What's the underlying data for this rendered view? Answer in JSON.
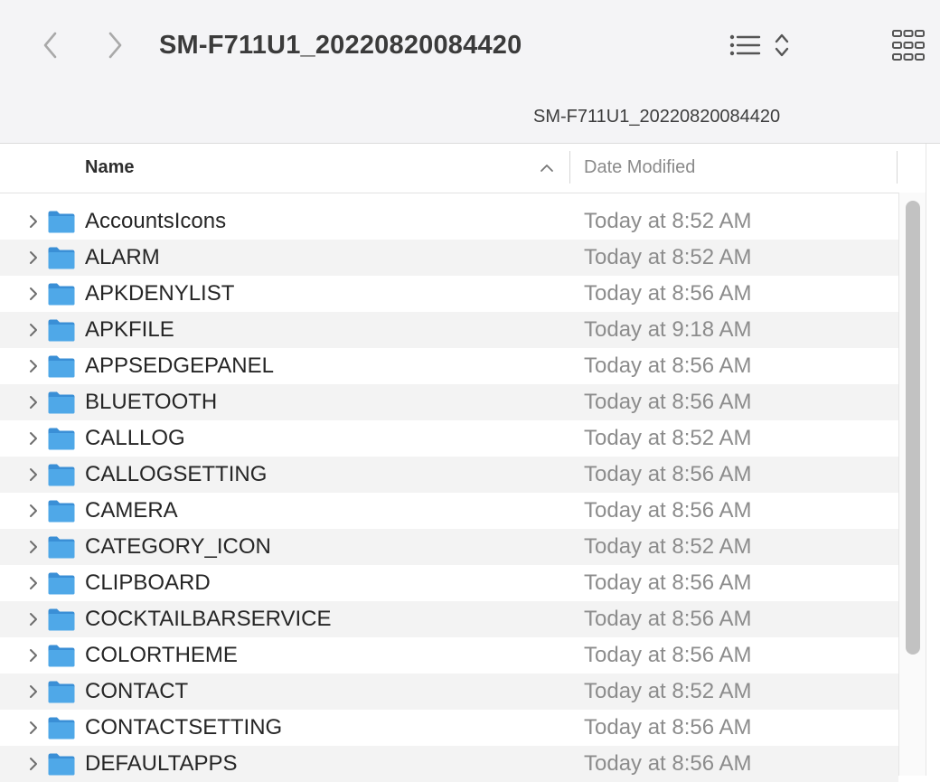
{
  "toolbar": {
    "title": "SM-F711U1_20220820084420",
    "back_icon": "chevron-left-icon",
    "forward_icon": "chevron-right-icon",
    "view_icon": "list-view-icon",
    "grid_icon": "grid-view-icon"
  },
  "path_bar": {
    "label": "SM-F711U1_20220820084420"
  },
  "columns": {
    "name": "Name",
    "date_modified": "Date Modified",
    "sort": "ascending"
  },
  "colors": {
    "folder": "#4fa8e8",
    "folder_tab": "#3a8fd6",
    "alt_row": "#f3f3f3",
    "toolbar_bg": "#f4f4f6"
  },
  "files": [
    {
      "name": "AccountsIcons",
      "date": "Today at 8:52 AM"
    },
    {
      "name": "ALARM",
      "date": "Today at 8:52 AM"
    },
    {
      "name": "APKDENYLIST",
      "date": "Today at 8:56 AM"
    },
    {
      "name": "APKFILE",
      "date": "Today at 9:18 AM"
    },
    {
      "name": "APPSEDGEPANEL",
      "date": "Today at 8:56 AM"
    },
    {
      "name": "BLUETOOTH",
      "date": "Today at 8:56 AM"
    },
    {
      "name": "CALLLOG",
      "date": "Today at 8:52 AM"
    },
    {
      "name": "CALLOGSETTING",
      "date": "Today at 8:56 AM"
    },
    {
      "name": "CAMERA",
      "date": "Today at 8:56 AM"
    },
    {
      "name": "CATEGORY_ICON",
      "date": "Today at 8:52 AM"
    },
    {
      "name": "CLIPBOARD",
      "date": "Today at 8:56 AM"
    },
    {
      "name": "COCKTAILBARSERVICE",
      "date": "Today at 8:56 AM"
    },
    {
      "name": "COLORTHEME",
      "date": "Today at 8:56 AM"
    },
    {
      "name": "CONTACT",
      "date": "Today at 8:52 AM"
    },
    {
      "name": "CONTACTSETTING",
      "date": "Today at 8:56 AM"
    },
    {
      "name": "DEFAULTAPPS",
      "date": "Today at 8:56 AM"
    }
  ]
}
